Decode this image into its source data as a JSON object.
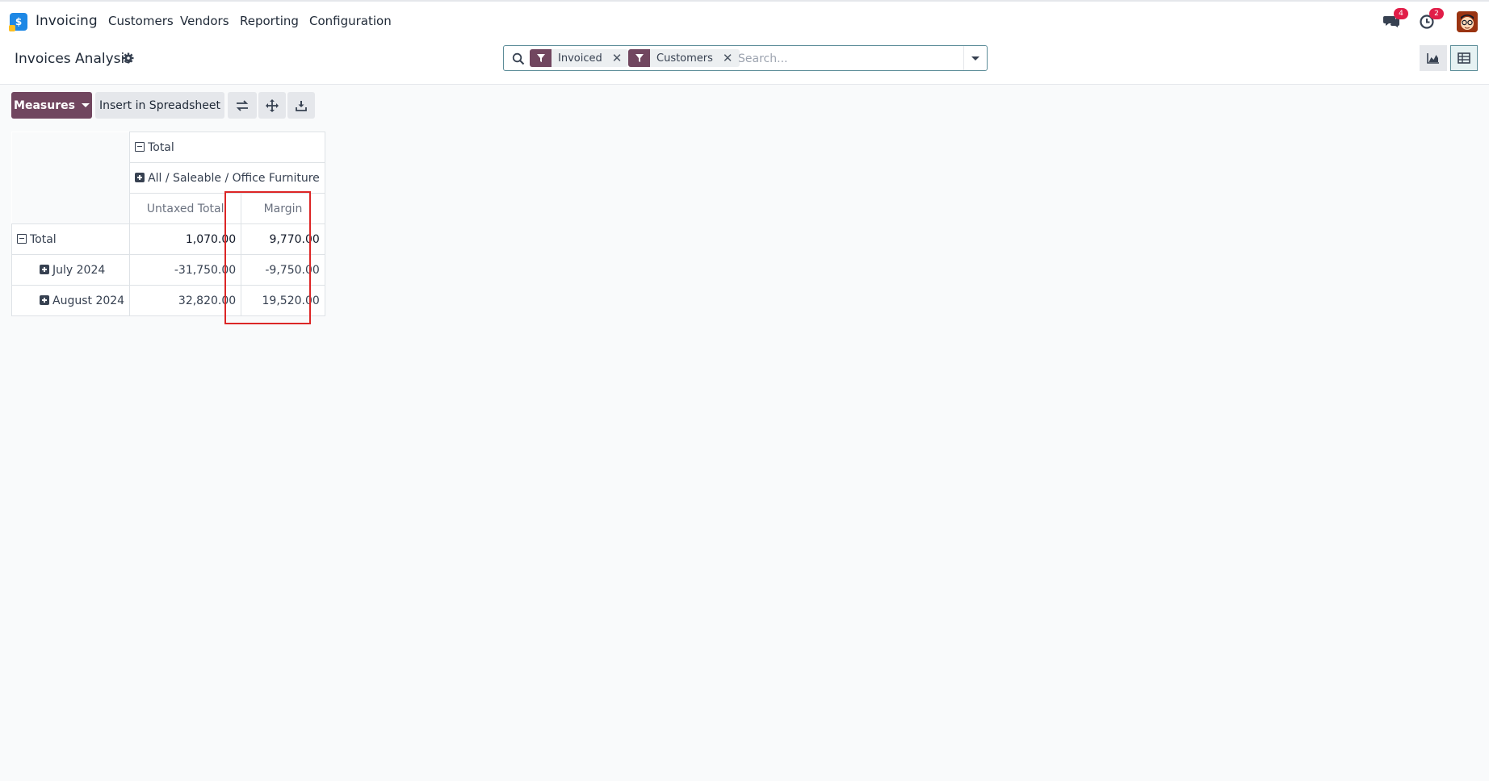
{
  "app": {
    "name": "Invoicing"
  },
  "nav": {
    "items": [
      "Customers",
      "Vendors",
      "Reporting",
      "Configuration"
    ]
  },
  "topbar": {
    "messages_count": "4",
    "activities_count": "2"
  },
  "page": {
    "title": "Invoices Analysis"
  },
  "search": {
    "facets": [
      "Invoiced",
      "Customers"
    ],
    "placeholder": "Search..."
  },
  "toolbar": {
    "measures_label": "Measures",
    "insert_label": "Insert in Spreadsheet"
  },
  "pivot": {
    "col_total_header": "Total",
    "col_group_header": "All / Saleable / Office Furniture",
    "measures": [
      "Untaxed Total",
      "Margin"
    ],
    "rows": [
      {
        "label": "Total",
        "untaxed": "1,070.00",
        "margin": "9,770.00"
      },
      {
        "label": "July 2024",
        "untaxed": "-31,750.00",
        "margin": "-9,750.00"
      },
      {
        "label": "August 2024",
        "untaxed": "32,820.00",
        "margin": "19,520.00"
      }
    ]
  },
  "colors": {
    "brand": "#71465f",
    "accent": "#5d8d99",
    "highlight": "#dc2626"
  }
}
